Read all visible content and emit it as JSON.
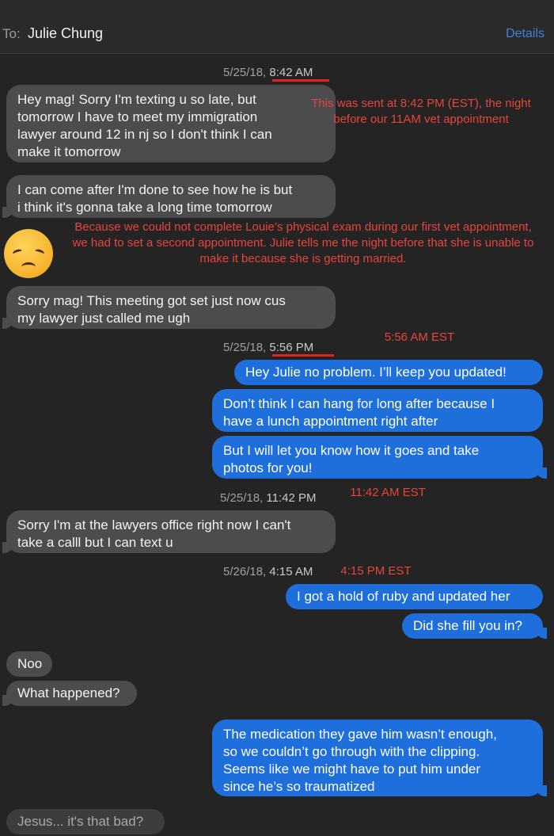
{
  "header": {
    "to_label": "To:",
    "contact": "Julie Chung",
    "details": "Details"
  },
  "timestamps": [
    {
      "date": "5/25/18, ",
      "time": "8:42 AM"
    },
    {
      "date": "5/25/18, ",
      "time": "5:56 PM"
    },
    {
      "date": "5/25/18, ",
      "time": "11:42 PM"
    },
    {
      "date": "5/26/18, ",
      "time": "4:15 AM"
    }
  ],
  "messages": [
    {
      "from": "them",
      "text": "Hey mag! Sorry I'm texting u so late, but\ntomorrow I have to meet my immigration\nlawyer around 12 in nj so I don't think I can\nmake it tomorrow"
    },
    {
      "from": "them",
      "text": "I can come after I'm done to see how he is but\ni think it's gonna take a long time tomorrow"
    },
    {
      "from": "them",
      "text": "Sorry mag! This meeting got set just now cus\nmy lawyer just called me ugh"
    },
    {
      "from": "me",
      "text": "Hey Julie no problem. I’ll keep you updated!"
    },
    {
      "from": "me",
      "text": "Don’t think I can hang for long after because I\nhave a lunch appointment right after"
    },
    {
      "from": "me",
      "text": "But I will let you know how it goes and take\nphotos for you!"
    },
    {
      "from": "them",
      "text": "Sorry I'm at the lawyers office right now I can't\ntake a calll but I can text u"
    },
    {
      "from": "me",
      "text": "I got a hold of ruby and updated her"
    },
    {
      "from": "me",
      "text": "Did she fill you in?"
    },
    {
      "from": "them",
      "text": "Noo"
    },
    {
      "from": "them",
      "text": "What happened?"
    },
    {
      "from": "me",
      "text": "The medication they gave him wasn’t enough,\nso we couldn’t go through with the clipping.\nSeems like we might have to put him under\nsince he’s so traumatized"
    },
    {
      "from": "them",
      "text": "Jesus... it's that bad?"
    }
  ],
  "annotations": {
    "sent_note": "This was sent at 8:42 PM (EST), the night\nbefore our 11AM vet appointment",
    "context_note": "Because we could not complete Louie’s physical exam\nduring our first vet appointment, we had to set a second appointment.\nJulie tells me the night before that she is unable to make it because she is\ngetting married.",
    "est_1": "5:56 AM EST",
    "est_2": "11:42 AM EST",
    "est_3": "4:15 PM EST"
  },
  "emoji": "disappointed-face",
  "colors": {
    "incoming": "#4c4c4e",
    "outgoing": "#1e6fdb",
    "annotation": "#e8443a",
    "link": "#3d84d9"
  }
}
